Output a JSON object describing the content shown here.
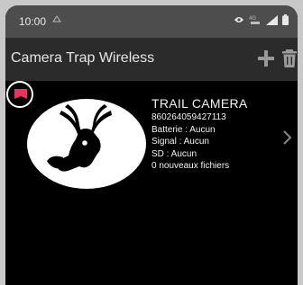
{
  "status_bar": {
    "time": "10:00",
    "notification_icon": "notification-icon",
    "icons": [
      "eye-icon",
      "network-type-icon",
      "signal-icon",
      "battery-icon"
    ]
  },
  "app_bar": {
    "title": "Camera Trap Wireless",
    "add_icon": "plus-icon",
    "delete_icon": "trash-icon"
  },
  "flag": {
    "icon": "flag-icon",
    "color": "#e8345c"
  },
  "camera": {
    "name": "TRAIL CAMERA",
    "id": "860264059427113",
    "battery": "Batterie : Aucun",
    "signal": "Signal : Aucun",
    "sd": "SD : Aucun",
    "new_files": "0 nouveaux fichiers",
    "avatar_icon": "deer-silhouette-icon",
    "chevron_icon": "chevron-right-icon"
  },
  "colors": {
    "status_bar": "#4d4d4d",
    "app_bar": "#2b2b2b",
    "background": "#000000",
    "text": "#f2f2f2"
  }
}
